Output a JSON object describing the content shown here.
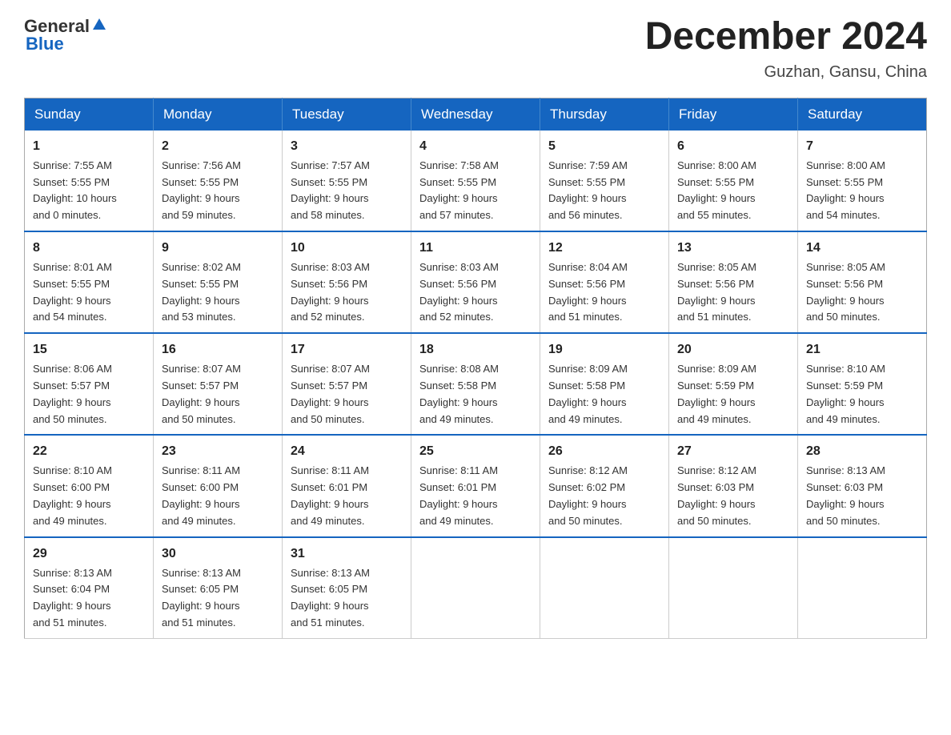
{
  "header": {
    "logo_general": "General",
    "logo_blue": "Blue",
    "title": "December 2024",
    "subtitle": "Guzhan, Gansu, China"
  },
  "columns": [
    "Sunday",
    "Monday",
    "Tuesday",
    "Wednesday",
    "Thursday",
    "Friday",
    "Saturday"
  ],
  "weeks": [
    [
      {
        "day": "1",
        "info": "Sunrise: 7:55 AM\nSunset: 5:55 PM\nDaylight: 10 hours\nand 0 minutes."
      },
      {
        "day": "2",
        "info": "Sunrise: 7:56 AM\nSunset: 5:55 PM\nDaylight: 9 hours\nand 59 minutes."
      },
      {
        "day": "3",
        "info": "Sunrise: 7:57 AM\nSunset: 5:55 PM\nDaylight: 9 hours\nand 58 minutes."
      },
      {
        "day": "4",
        "info": "Sunrise: 7:58 AM\nSunset: 5:55 PM\nDaylight: 9 hours\nand 57 minutes."
      },
      {
        "day": "5",
        "info": "Sunrise: 7:59 AM\nSunset: 5:55 PM\nDaylight: 9 hours\nand 56 minutes."
      },
      {
        "day": "6",
        "info": "Sunrise: 8:00 AM\nSunset: 5:55 PM\nDaylight: 9 hours\nand 55 minutes."
      },
      {
        "day": "7",
        "info": "Sunrise: 8:00 AM\nSunset: 5:55 PM\nDaylight: 9 hours\nand 54 minutes."
      }
    ],
    [
      {
        "day": "8",
        "info": "Sunrise: 8:01 AM\nSunset: 5:55 PM\nDaylight: 9 hours\nand 54 minutes."
      },
      {
        "day": "9",
        "info": "Sunrise: 8:02 AM\nSunset: 5:55 PM\nDaylight: 9 hours\nand 53 minutes."
      },
      {
        "day": "10",
        "info": "Sunrise: 8:03 AM\nSunset: 5:56 PM\nDaylight: 9 hours\nand 52 minutes."
      },
      {
        "day": "11",
        "info": "Sunrise: 8:03 AM\nSunset: 5:56 PM\nDaylight: 9 hours\nand 52 minutes."
      },
      {
        "day": "12",
        "info": "Sunrise: 8:04 AM\nSunset: 5:56 PM\nDaylight: 9 hours\nand 51 minutes."
      },
      {
        "day": "13",
        "info": "Sunrise: 8:05 AM\nSunset: 5:56 PM\nDaylight: 9 hours\nand 51 minutes."
      },
      {
        "day": "14",
        "info": "Sunrise: 8:05 AM\nSunset: 5:56 PM\nDaylight: 9 hours\nand 50 minutes."
      }
    ],
    [
      {
        "day": "15",
        "info": "Sunrise: 8:06 AM\nSunset: 5:57 PM\nDaylight: 9 hours\nand 50 minutes."
      },
      {
        "day": "16",
        "info": "Sunrise: 8:07 AM\nSunset: 5:57 PM\nDaylight: 9 hours\nand 50 minutes."
      },
      {
        "day": "17",
        "info": "Sunrise: 8:07 AM\nSunset: 5:57 PM\nDaylight: 9 hours\nand 50 minutes."
      },
      {
        "day": "18",
        "info": "Sunrise: 8:08 AM\nSunset: 5:58 PM\nDaylight: 9 hours\nand 49 minutes."
      },
      {
        "day": "19",
        "info": "Sunrise: 8:09 AM\nSunset: 5:58 PM\nDaylight: 9 hours\nand 49 minutes."
      },
      {
        "day": "20",
        "info": "Sunrise: 8:09 AM\nSunset: 5:59 PM\nDaylight: 9 hours\nand 49 minutes."
      },
      {
        "day": "21",
        "info": "Sunrise: 8:10 AM\nSunset: 5:59 PM\nDaylight: 9 hours\nand 49 minutes."
      }
    ],
    [
      {
        "day": "22",
        "info": "Sunrise: 8:10 AM\nSunset: 6:00 PM\nDaylight: 9 hours\nand 49 minutes."
      },
      {
        "day": "23",
        "info": "Sunrise: 8:11 AM\nSunset: 6:00 PM\nDaylight: 9 hours\nand 49 minutes."
      },
      {
        "day": "24",
        "info": "Sunrise: 8:11 AM\nSunset: 6:01 PM\nDaylight: 9 hours\nand 49 minutes."
      },
      {
        "day": "25",
        "info": "Sunrise: 8:11 AM\nSunset: 6:01 PM\nDaylight: 9 hours\nand 49 minutes."
      },
      {
        "day": "26",
        "info": "Sunrise: 8:12 AM\nSunset: 6:02 PM\nDaylight: 9 hours\nand 50 minutes."
      },
      {
        "day": "27",
        "info": "Sunrise: 8:12 AM\nSunset: 6:03 PM\nDaylight: 9 hours\nand 50 minutes."
      },
      {
        "day": "28",
        "info": "Sunrise: 8:13 AM\nSunset: 6:03 PM\nDaylight: 9 hours\nand 50 minutes."
      }
    ],
    [
      {
        "day": "29",
        "info": "Sunrise: 8:13 AM\nSunset: 6:04 PM\nDaylight: 9 hours\nand 51 minutes."
      },
      {
        "day": "30",
        "info": "Sunrise: 8:13 AM\nSunset: 6:05 PM\nDaylight: 9 hours\nand 51 minutes."
      },
      {
        "day": "31",
        "info": "Sunrise: 8:13 AM\nSunset: 6:05 PM\nDaylight: 9 hours\nand 51 minutes."
      },
      {
        "day": "",
        "info": ""
      },
      {
        "day": "",
        "info": ""
      },
      {
        "day": "",
        "info": ""
      },
      {
        "day": "",
        "info": ""
      }
    ]
  ]
}
